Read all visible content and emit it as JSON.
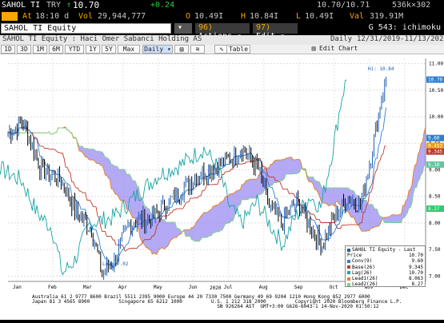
{
  "quote": {
    "ticker": "SAHOL TI",
    "currency": "TRY",
    "last_arrow": "↑",
    "last": "10.70",
    "change": "+0.24",
    "bid_ask": "10.70/10.71",
    "size": "536k×302",
    "at_label": "At",
    "time": "18:10 d",
    "vol_label": "Vol",
    "volume": "29,944,777",
    "open_label": "O",
    "open": "10.49I",
    "high_label": "H",
    "high": "10.84I",
    "low_label": "L",
    "low": "10.49I",
    "val_label": "Val",
    "value": "319.91M"
  },
  "toolbar": {
    "sec_field": "SAHOL TI Equity",
    "actions_num": "96)",
    "actions_label": "Actions ▾",
    "edit_num": "97)",
    "edit_label": "Edit ▾",
    "title_right": "G 543: ichimoku"
  },
  "security_line": {
    "name": "SAHOL TI Equity : Haci Omer Sabanci Holding AS",
    "period_label": "Daily",
    "date_range": "12/31/2019-11/13/2020"
  },
  "timeframes": [
    "1D",
    "3D",
    "1M",
    "6M",
    "YTD",
    "1Y",
    "5Y",
    "Max"
  ],
  "period_select": "Daily ▾",
  "table_label": "Table",
  "edit_chart_label": "Edit Chart",
  "chart_data": {
    "type": "line",
    "title": "",
    "x_labels": [
      "Jan",
      "Feb",
      "Mar",
      "Apr",
      "May",
      "Jun",
      "Jul",
      "Aug",
      "Sep",
      "Oct",
      "Nov",
      "Dec"
    ],
    "year_label": "2020",
    "ylim": [
      6.9,
      11.1
    ],
    "y_ticks": [
      "11.00",
      "10.50",
      "10.00",
      "9.50",
      "9.00",
      "8.50",
      "8.00",
      "7.50",
      "7.00"
    ],
    "hi_label": "Hi: 10.84",
    "low_label": "Low: 7.02",
    "right_tags": [
      {
        "text": "10.70",
        "color": "#2f7fd0"
      },
      {
        "text": "9.60",
        "color": "#2f7fd0"
      },
      {
        "text": "9.452",
        "color": "#f39c12"
      },
      {
        "text": "9.345",
        "color": "#c0392b"
      },
      {
        "text": "9.10",
        "color": "#5fc8a0"
      },
      {
        "text": "8.27",
        "color": "#2ecc71"
      }
    ],
    "series": [
      {
        "name": "SAHOL TI Equity - Last Price",
        "value": "10.70",
        "color": "#1f5fb5"
      },
      {
        "name": "Conv(9)",
        "value": "9.60",
        "color": "#2f7fd0"
      },
      {
        "name": "Base(26)",
        "value": "9.345",
        "color": "#c0392b"
      },
      {
        "name": "Lag(26)",
        "value": "10.70",
        "color": "#1aa3a3"
      },
      {
        "name": "Lead1(26)",
        "value": "8.063",
        "color": "#e67e22"
      },
      {
        "name": "Lead2(26)",
        "value": "8.27",
        "color": "#7bd389"
      }
    ]
  },
  "footer": {
    "line1": "Australia 61 2 9777 8600 Brazil 5511 2395 9000 Europe 44 20 7330 7500 Germany 49 69 9204 1210 Hong Kong 852 2977 6000",
    "line2": "Japan 81 3 4565 8900          Singapore 65 6212 1000          U.S. 1 212 318 2000          Copyright 2020 Bloomberg Finance L.P.",
    "line3": "                                                                SN 926264 AST  GMT+3:00 G626-6043-1 14-Nov-2020 01:50:12"
  }
}
